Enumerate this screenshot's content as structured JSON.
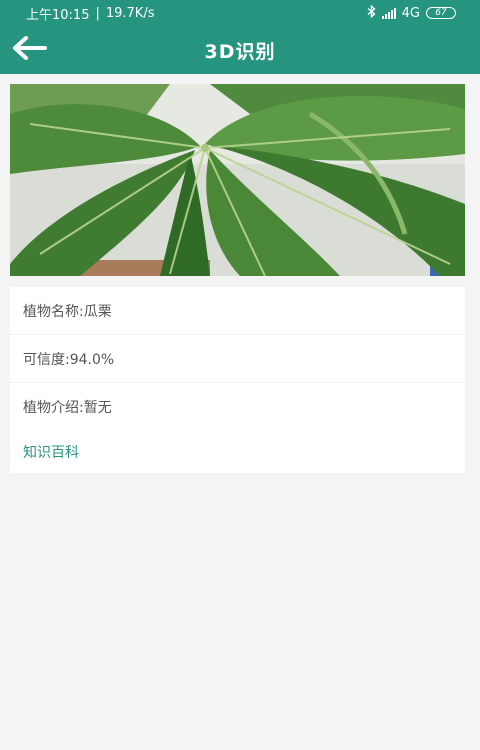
{
  "status_bar": {
    "time": "上午10:15",
    "separator": "|",
    "net_speed": "19.7K/s",
    "bluetooth_icon": "bluetooth-icon",
    "signal_icon": "signal-icon",
    "network": "4G",
    "battery": "67"
  },
  "header": {
    "title": "3D识别",
    "back_icon": "back-arrow-icon"
  },
  "result": {
    "photo": "plant-leaves-photo",
    "plant_name": "植物名称:瓜栗",
    "confidence": "可信度:94.0%",
    "introduction": "植物介绍:暂无",
    "encyclopedia_link": "知识百科"
  },
  "colors": {
    "accent": "#26957f",
    "background": "#f4f4f4",
    "card": "#ffffff",
    "text": "#555555"
  }
}
